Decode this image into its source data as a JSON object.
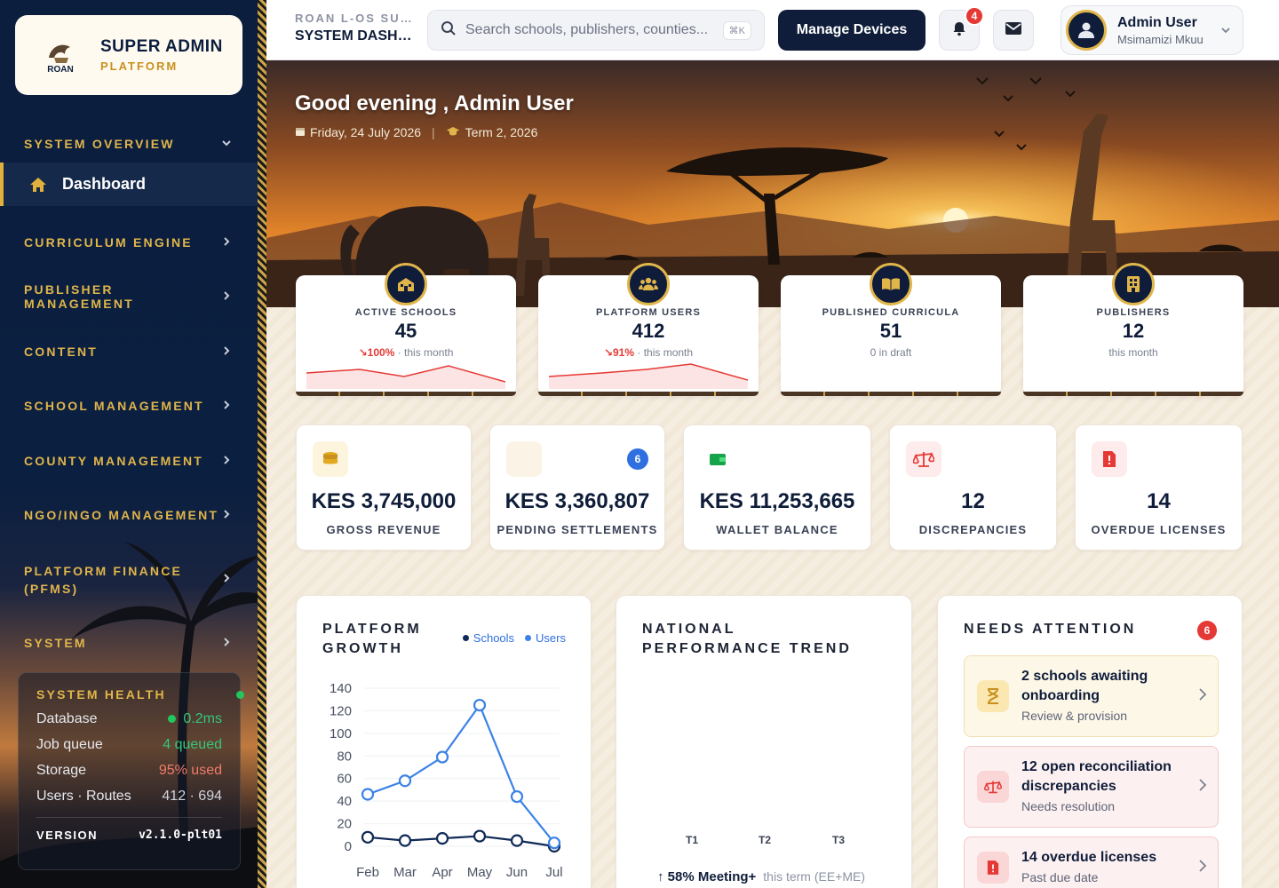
{
  "brand": {
    "title": "SUPER ADMIN",
    "subtitle": "PLATFORM",
    "logo_text": "ROAN"
  },
  "sidebar": {
    "items": [
      {
        "label": "SYSTEM OVERVIEW",
        "chevron": "chevron-down"
      },
      {
        "label": "Dashboard",
        "active": true,
        "icon": "home-icon"
      },
      {
        "label": "CURRICULUM ENGINE",
        "chevron": "chevron-right"
      },
      {
        "label": "PUBLISHER MANAGEMENT",
        "chevron": "chevron-right"
      },
      {
        "label": "CONTENT",
        "chevron": "chevron-right"
      },
      {
        "label": "SCHOOL MANAGEMENT",
        "chevron": "chevron-right"
      },
      {
        "label": "COUNTY MANAGEMENT",
        "chevron": "chevron-right"
      },
      {
        "label": "NGO/INGO MANAGEMENT",
        "chevron": "chevron-right"
      },
      {
        "label": "PLATFORM FINANCE (PFMS)",
        "chevron": "chevron-right"
      },
      {
        "label": "SYSTEM",
        "chevron": "chevron-right"
      }
    ],
    "health": {
      "title": "SYSTEM HEALTH",
      "rows": [
        {
          "label": "Database",
          "value": "0.2ms"
        },
        {
          "label": "Job queue",
          "value": "4 queued"
        },
        {
          "label": "Storage",
          "value": "95% used"
        },
        {
          "label": "Users · Routes",
          "value": "412 · 694"
        }
      ],
      "version_label": "VERSION",
      "version_value": "v2.1.0-plt01"
    }
  },
  "topbar": {
    "eyebrow": "ROAN L-OS SUPER ADMIN",
    "title": "SYSTEM DASHBOARD",
    "search_placeholder": "Search schools, publishers, counties...",
    "search_shortcut": "⌘K",
    "manage_button": "Manage Devices",
    "notifications_count": "4",
    "user_name": "Admin User",
    "user_sub": "Msimamizi Mkuu"
  },
  "hero": {
    "greeting": "Good evening , Admin User",
    "date": "Friday, 24 July 2026",
    "term": "Term 2, 2026"
  },
  "stats": [
    {
      "label": "ACTIVE SCHOOLS",
      "value": "45",
      "delta": "↘100%",
      "note": "· this month",
      "icon": "school-icon"
    },
    {
      "label": "PLATFORM USERS",
      "value": "412",
      "delta": "↘91%",
      "note": "· this month",
      "icon": "users-icon"
    },
    {
      "label": "PUBLISHED CURRICULA",
      "value": "51",
      "note": "0 in draft",
      "icon": "book-icon"
    },
    {
      "label": "PUBLISHERS",
      "value": "12",
      "note": "this month",
      "icon": "building-icon"
    }
  ],
  "kpis": [
    {
      "value": "KES 3,745,000",
      "label": "GROSS REVENUE",
      "icon": "coins-icon"
    },
    {
      "value": "KES 3,360,807",
      "label": "PENDING SETTLEMENTS",
      "badge": "6",
      "icon": "clock-icon"
    },
    {
      "value": "KES 11,253,665",
      "label": "WALLET BALANCE",
      "icon": "wallet-icon"
    },
    {
      "value": "12",
      "label": "DISCREPANCIES",
      "icon": "scale-icon"
    },
    {
      "value": "14",
      "label": "OVERDUE LICENSES",
      "icon": "file-alert-icon"
    }
  ],
  "growth": {
    "title": "PLATFORM GROWTH",
    "legend": [
      "Schools",
      "Users"
    ]
  },
  "chart_data": {
    "type": "line",
    "categories": [
      "Feb",
      "Mar",
      "Apr",
      "May",
      "Jun",
      "Jul"
    ],
    "series": [
      {
        "name": "Schools",
        "values": [
          8,
          5,
          7,
          9,
          5,
          0
        ],
        "color": "#0f2a56"
      },
      {
        "name": "Users",
        "values": [
          46,
          58,
          79,
          125,
          44,
          3
        ],
        "color": "#3b82e6"
      }
    ],
    "ylim": [
      0,
      140
    ],
    "yticks": [
      0,
      20,
      40,
      60,
      80,
      100,
      120,
      140
    ],
    "grid": true,
    "legend_position": "top-right"
  },
  "trend": {
    "title": "NATIONAL PERFORMANCE TREND",
    "terms": [
      "T1",
      "T2",
      "T3"
    ],
    "foot": "↑ 58% Meeting+",
    "foot_note": "this term (EE+ME)"
  },
  "attention": {
    "title": "NEEDS ATTENTION",
    "count": "6",
    "items": [
      {
        "title": "2 schools awaiting onboarding",
        "sub": "Review & provision",
        "icon": "hourglass-icon"
      },
      {
        "title": "12 open reconciliation discrepancies",
        "sub": "Needs resolution",
        "icon": "scale-icon"
      },
      {
        "title": "14 overdue licenses",
        "sub": "Past due date",
        "icon": "file-alert-icon"
      }
    ]
  },
  "colors": {
    "navy": "#0f1d3a",
    "gold": "#e0b54a",
    "red": "#e53935",
    "blue": "#3b82e6"
  }
}
